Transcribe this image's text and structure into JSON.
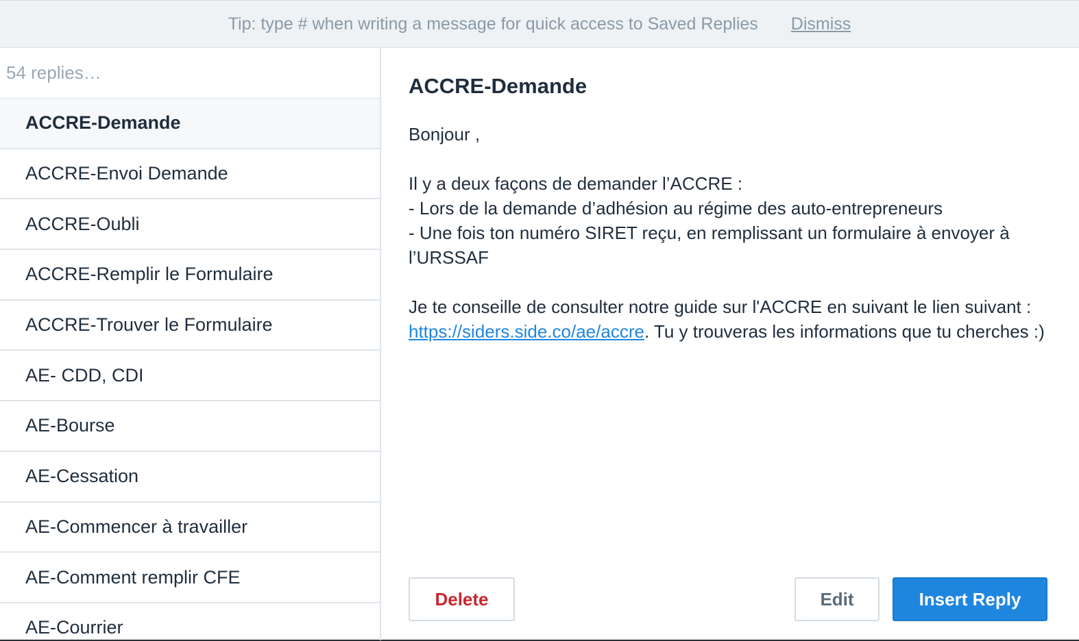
{
  "tip_bar": {
    "text": "Tip: type # when writing a message for quick access to Saved Replies",
    "dismiss_label": "Dismiss"
  },
  "sidebar": {
    "search_placeholder": "54 replies…",
    "items": [
      {
        "label": "ACCRE-Demande",
        "selected": true
      },
      {
        "label": "ACCRE-Envoi Demande"
      },
      {
        "label": "ACCRE-Oubli"
      },
      {
        "label": "ACCRE-Remplir le Formulaire"
      },
      {
        "label": "ACCRE-Trouver le Formulaire"
      },
      {
        "label": "AE- CDD, CDI"
      },
      {
        "label": "AE-Bourse"
      },
      {
        "label": "AE-Cessation"
      },
      {
        "label": "AE-Commencer à travailler"
      },
      {
        "label": "AE-Comment remplir CFE"
      },
      {
        "label": "AE-Courrier"
      }
    ]
  },
  "detail": {
    "title": "ACCRE-Demande",
    "greeting": "Bonjour ,",
    "para1_line1": "Il y a deux façons de demander l’ACCRE :",
    "para1_line2": "- Lors de la demande d’adhésion au régime des auto-entrepreneurs",
    "para1_line3": "- Une fois ton numéro SIRET reçu, en remplissant un formulaire à envoyer à l’URSSAF",
    "para2_before_link": "Je te conseille de consulter notre guide sur l'ACCRE en suivant le lien suivant : ",
    "para2_link": "https://siders.side.co/ae/accre",
    "para2_after_link": ". Tu y trouveras les informations que tu cherches :)"
  },
  "actions": {
    "delete_label": "Delete",
    "edit_label": "Edit",
    "insert_label": "Insert Reply"
  },
  "colors": {
    "accent": "#1f86e0",
    "danger": "#c8282d"
  }
}
